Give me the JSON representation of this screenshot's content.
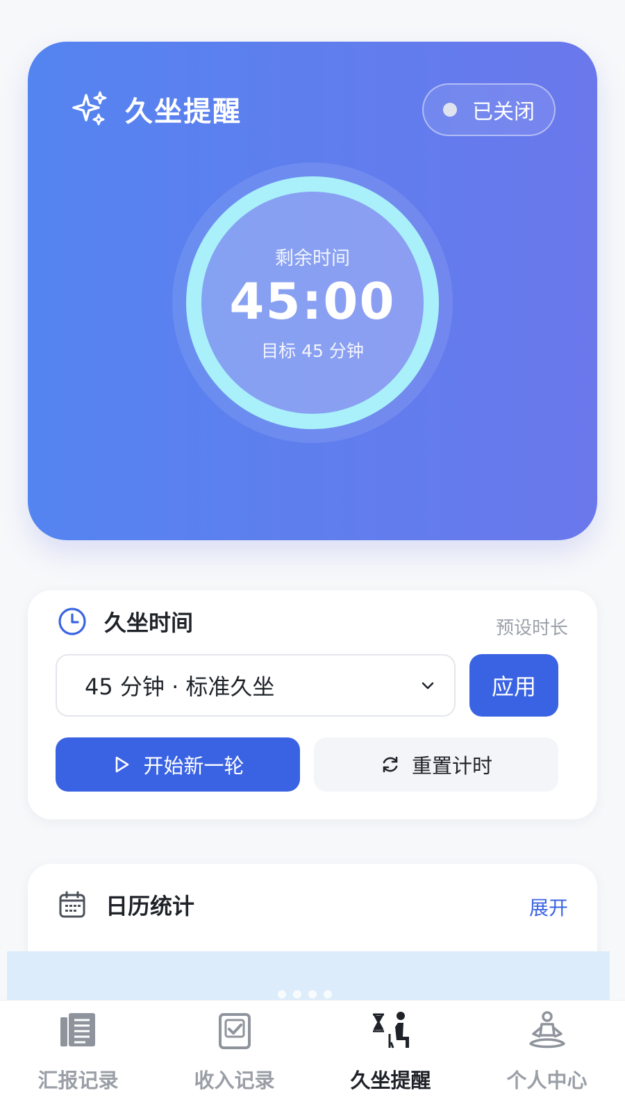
{
  "hero": {
    "title": "久坐提醒",
    "status_label": "已关闭",
    "remaining_label": "剩余时间",
    "time": "45:00",
    "target": "目标 45 分钟",
    "icon": "sparkle-icon"
  },
  "setting": {
    "title": "久坐时间",
    "subtitle": "预设时长",
    "selected_option": "45 分钟 · 标准久坐",
    "apply_label": "应用",
    "start_label": "开始新一轮",
    "reset_label": "重置计时",
    "icon": "clock-icon"
  },
  "calendar": {
    "title": "日历统计",
    "expand_label": "展开",
    "icon": "calendar-icon"
  },
  "nav": {
    "items": [
      {
        "label": "汇报记录",
        "icon": "report-icon"
      },
      {
        "label": "收入记录",
        "icon": "income-check-icon"
      },
      {
        "label": "久坐提醒",
        "icon": "sitting-timer-icon"
      },
      {
        "label": "个人中心",
        "icon": "meditation-person-icon"
      }
    ],
    "active_index": 2
  },
  "colors": {
    "primary": "#3a63e3",
    "hero_gradient_start": "#5484f0",
    "hero_gradient_end": "#6a78ec",
    "ring": "#a9f0fb"
  }
}
